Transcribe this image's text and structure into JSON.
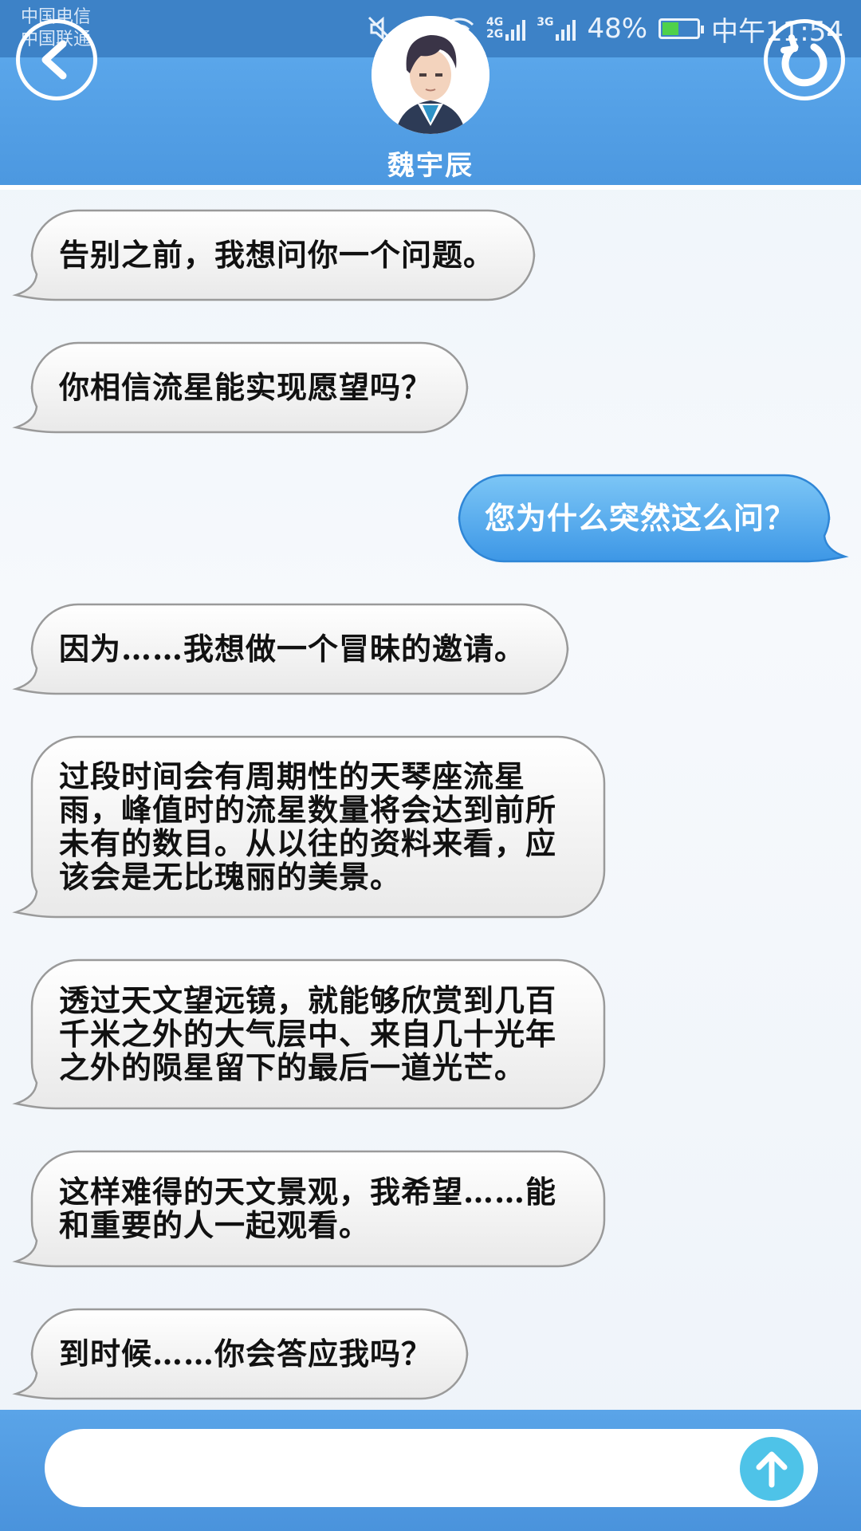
{
  "status_bar": {
    "carrier_1": "中国电信",
    "carrier_2": "中国联通",
    "net_4g_top": "4G",
    "net_4g_bottom": "2G",
    "net_3g": "3G",
    "battery_percent": "48%",
    "battery_level": 0.48,
    "time": "中午11:54"
  },
  "header": {
    "contact_name": "魏宇辰",
    "back_icon": "chevron-left-icon",
    "refresh_icon": "refresh-icon"
  },
  "messages": [
    {
      "side": "received",
      "text": "告别之前，我想问你一个问题。"
    },
    {
      "side": "received",
      "text": "你相信流星能实现愿望吗？"
    },
    {
      "side": "sent",
      "text": "您为什么突然这么问？"
    },
    {
      "side": "received",
      "text": "因为……我想做一个冒昧的邀请。"
    },
    {
      "side": "received",
      "text": "过段时间会有周期性的天琴座流星雨，峰值时的流星数量将会达到前所未有的数目。从以往的资料来看，应该会是无比瑰丽的美景。"
    },
    {
      "side": "received",
      "text": "透过天文望远镜，就能够欣赏到几百千米之外的大气层中、来自几十光年之外的陨星留下的最后一道光芒。"
    },
    {
      "side": "received",
      "text": "这样难得的天文景观，我希望……能和重要的人一起观看。"
    },
    {
      "side": "received",
      "text": "到时候……你会答应我吗？"
    }
  ],
  "input": {
    "value": "",
    "placeholder": ""
  },
  "colors": {
    "header_blue": "#4c98e0",
    "sent_bubble": "#4aa3ec",
    "received_bubble": "#f4f4f4",
    "send_button": "#4ec3e8"
  }
}
